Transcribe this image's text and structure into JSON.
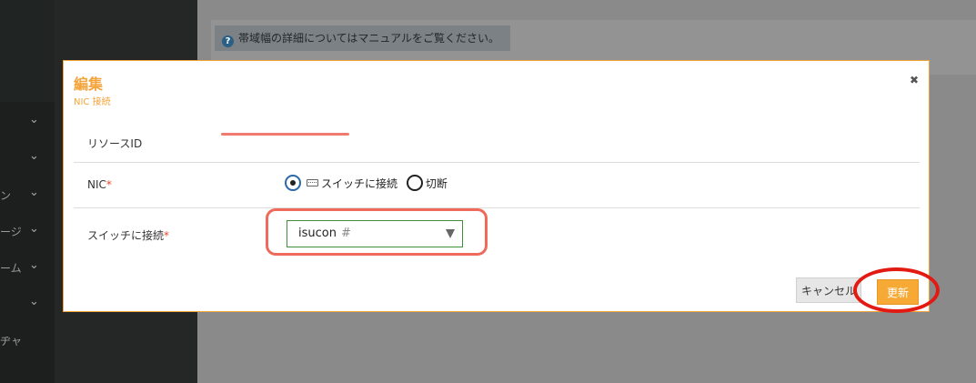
{
  "backdrop": {
    "notice_text": "帯域幅の詳細についてはマニュアルをご覧ください。",
    "help_icon": "?",
    "sidebar_items": [
      {
        "label": "",
        "top": 0
      },
      {
        "label": ""
      },
      {
        "label": "ン"
      },
      {
        "label": "ージ"
      },
      {
        "label": "ーム"
      },
      {
        "label": ""
      },
      {
        "label": "ヂャ"
      }
    ]
  },
  "modal": {
    "title": "編集",
    "subtitle": "NIC 接続",
    "close_icon": "✖",
    "fields": {
      "resource_id_label": "リソースID",
      "resource_id_value": "",
      "nic_label": "NIC",
      "nic_required": "*",
      "nic_options": [
        {
          "label": "スイッチに接続",
          "checked": true,
          "icon": "switch-icon"
        },
        {
          "label": "切断",
          "checked": false
        }
      ],
      "switch_label": "スイッチに接続",
      "switch_required": "*",
      "switch_value": "isucon",
      "switch_suffix": "#"
    },
    "buttons": {
      "cancel": "キャンセル",
      "update": "更新"
    }
  },
  "colors": {
    "accent": "#f4a33a",
    "required": "#e8452c",
    "select_border": "#3f8f3a",
    "annotation_red": "#e21a12"
  }
}
